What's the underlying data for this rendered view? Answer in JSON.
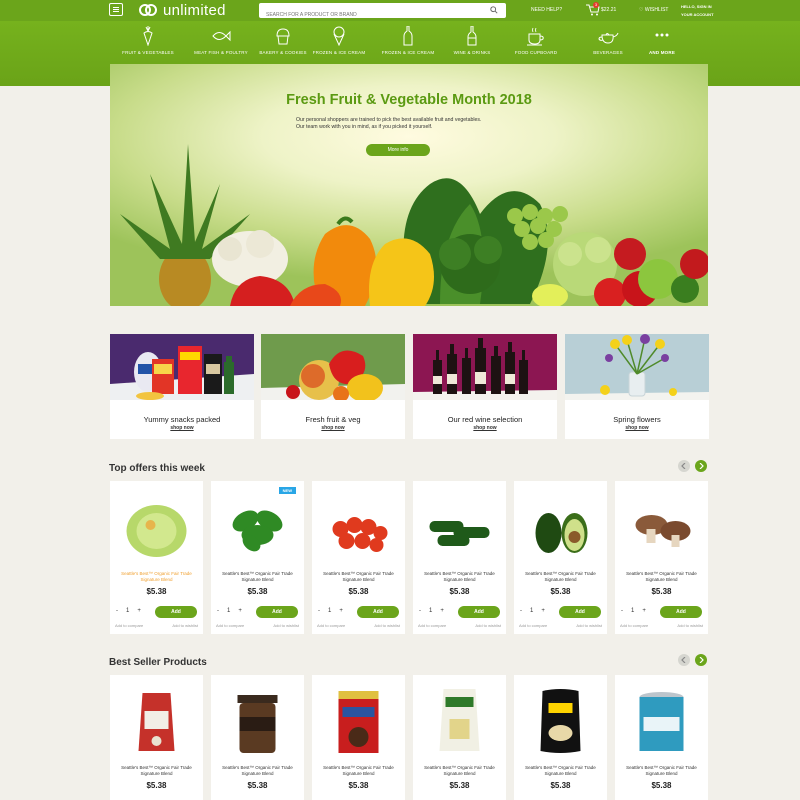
{
  "header": {
    "logo": "unlimited",
    "search_placeholder": "SEARCH FOR A PRODUCT OR BRAND",
    "need_help": "NEED HELP?",
    "cart_count": "3",
    "cart_total": "$22.21",
    "wishlist": "WISHLIST",
    "account_line1": "HELLO, SIGN IN",
    "account_line2": "YOUR ACCOUNT"
  },
  "categories": [
    {
      "label": "FRUIT & VEGETABLES",
      "icon": "carrot-icon"
    },
    {
      "label": "MEAT FISH & POULTRY",
      "icon": "fish-icon"
    },
    {
      "label": "BAKERY & COOKIES",
      "icon": "muffin-icon"
    },
    {
      "label": "FROZEN & ICE CREAM",
      "icon": "ice-cream-icon"
    },
    {
      "label": "FROZEN & ICE CREAM",
      "icon": "bottle-icon"
    },
    {
      "label": "WINE & DRINKS",
      "icon": "wine-bottle-icon"
    },
    {
      "label": "FOOD CUPBOARD",
      "icon": "coffee-cup-icon"
    },
    {
      "label": "BEVERAGES",
      "icon": "teapot-icon"
    },
    {
      "label": "AND MORE",
      "icon": "more-dots-icon"
    }
  ],
  "hero": {
    "title": "Fresh Fruit & Vegetable Month 2018",
    "line1": "Our personal shoppers are trained to pick the best available fruit and vegetables.",
    "line2": "Our team work with you in mind, as if you picked it yourself.",
    "button": "More info"
  },
  "promos": [
    {
      "title": "Yummy snacks packed",
      "link": "shop now"
    },
    {
      "title": "Fresh fruit & veg",
      "link": "shop now"
    },
    {
      "title": "Our red wine selection",
      "link": "shop now"
    },
    {
      "title": "Spring flowers",
      "link": "shop now"
    }
  ],
  "top_offers": {
    "title": "Top offers this week",
    "products": [
      {
        "name": "Seattle's Best™ Organic Fair Trade Signature Blend",
        "price": "$5.38",
        "qty": "1",
        "add": "Add",
        "compare": "Add to compare",
        "wishlist": "Add to wishlist",
        "badge": "",
        "image": "lettuce",
        "highlight": true
      },
      {
        "name": "Seattle's Best™ Organic Fair Trade Signature Blend",
        "price": "$5.38",
        "qty": "1",
        "add": "Add",
        "compare": "Add to compare",
        "wishlist": "Add to wishlist",
        "badge": "NEW",
        "image": "basil"
      },
      {
        "name": "Seattle's Best™ Organic Fair Trade Signature Blend",
        "price": "$5.38",
        "qty": "1",
        "add": "Add",
        "compare": "Add to compare",
        "wishlist": "Add to wishlist",
        "badge": "",
        "image": "cherry-tomatoes"
      },
      {
        "name": "Seattle's Best™ Organic Fair Trade Signature Blend",
        "price": "$5.38",
        "qty": "1",
        "add": "Add",
        "compare": "Add to compare",
        "wishlist": "Add to wishlist",
        "badge": "",
        "image": "cucumbers"
      },
      {
        "name": "Seattle's Best™ Organic Fair Trade Signature Blend",
        "price": "$5.38",
        "qty": "1",
        "add": "Add",
        "compare": "Add to compare",
        "wishlist": "Add to wishlist",
        "badge": "",
        "image": "avocado"
      },
      {
        "name": "Seattle's Best™ Organic Fair Trade Signature Blend",
        "price": "$5.38",
        "qty": "1",
        "add": "Add",
        "compare": "Add to compare",
        "wishlist": "Add to wishlist",
        "badge": "",
        "image": "mushrooms"
      }
    ]
  },
  "best_sellers": {
    "title": "Best Seller Products",
    "products": [
      {
        "name": "Seattle's Best™ Organic Fair Trade Signature Blend",
        "price": "$5.38",
        "image": "coffee-bag"
      },
      {
        "name": "Seattle's Best™ Organic Fair Trade Signature Blend",
        "price": "$5.38",
        "image": "coffee-jar"
      },
      {
        "name": "Seattle's Best™ Organic Fair Trade Signature Blend",
        "price": "$5.38",
        "image": "coffee-can"
      },
      {
        "name": "Seattle's Best™ Organic Fair Trade Signature Blend",
        "price": "$5.38",
        "image": "potato-pouch"
      },
      {
        "name": "Seattle's Best™ Organic Fair Trade Signature Blend",
        "price": "$5.38",
        "image": "chips-bag"
      },
      {
        "name": "Seattle's Best™ Organic Fair Trade Signature Blend",
        "price": "$5.38",
        "image": "tuna-can"
      }
    ]
  },
  "colors": {
    "brand_green": "#6ba51b",
    "new_badge": "#29a6e6",
    "cart_badge": "#e53d2e",
    "highlight_text": "#f0a030"
  }
}
